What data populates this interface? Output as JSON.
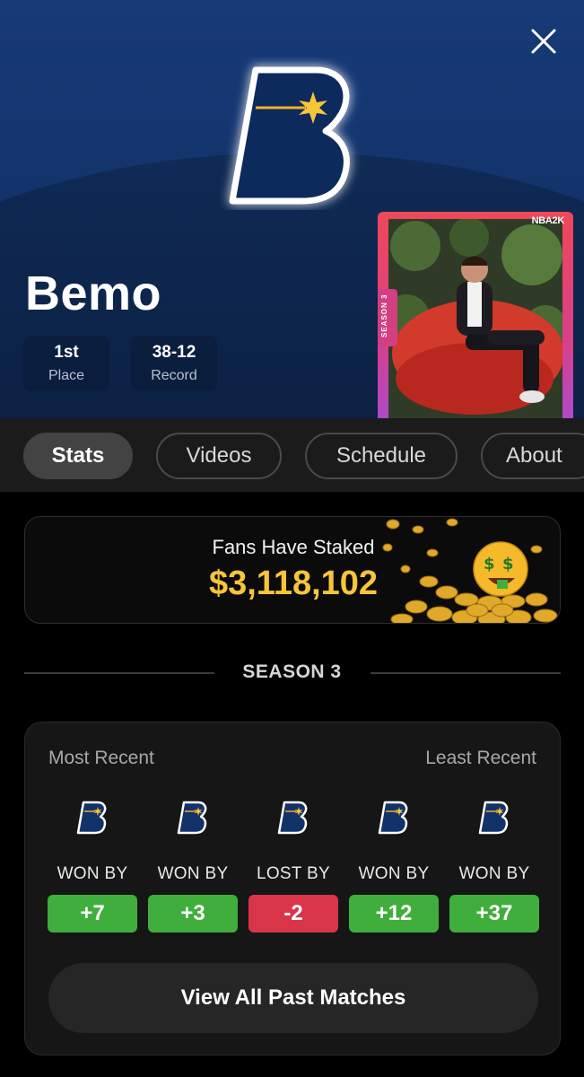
{
  "colors": {
    "win": "#3fae3c",
    "loss": "#d83549",
    "accent": "#f7c53a",
    "logo_blue": "#12326a"
  },
  "header": {
    "close_icon": "close-icon",
    "logo_icon": "b-star-logo-icon"
  },
  "player": {
    "name": "Bemo",
    "stats": [
      {
        "value": "1st",
        "label": "Place"
      },
      {
        "value": "38-12",
        "label": "Record"
      }
    ],
    "card": {
      "badge": "NBA2K",
      "season_tag": "SEASON 3"
    }
  },
  "tabs": [
    {
      "label": "Stats",
      "active": true
    },
    {
      "label": "Videos",
      "active": false
    },
    {
      "label": "Schedule",
      "active": false
    },
    {
      "label": "About",
      "active": false
    }
  ],
  "stake": {
    "label": "Fans Have Staked",
    "amount": "$3,118,102"
  },
  "season": {
    "title": "SEASON 3"
  },
  "results": {
    "most_recent_label": "Most Recent",
    "least_recent_label": "Least Recent",
    "matches": [
      {
        "result": "WON BY",
        "margin": "+7",
        "outcome": "win"
      },
      {
        "result": "WON BY",
        "margin": "+3",
        "outcome": "win"
      },
      {
        "result": "LOST BY",
        "margin": "-2",
        "outcome": "loss"
      },
      {
        "result": "WON BY",
        "margin": "+12",
        "outcome": "win"
      },
      {
        "result": "WON BY",
        "margin": "+37",
        "outcome": "win"
      }
    ],
    "view_all_label": "View All Past Matches"
  }
}
